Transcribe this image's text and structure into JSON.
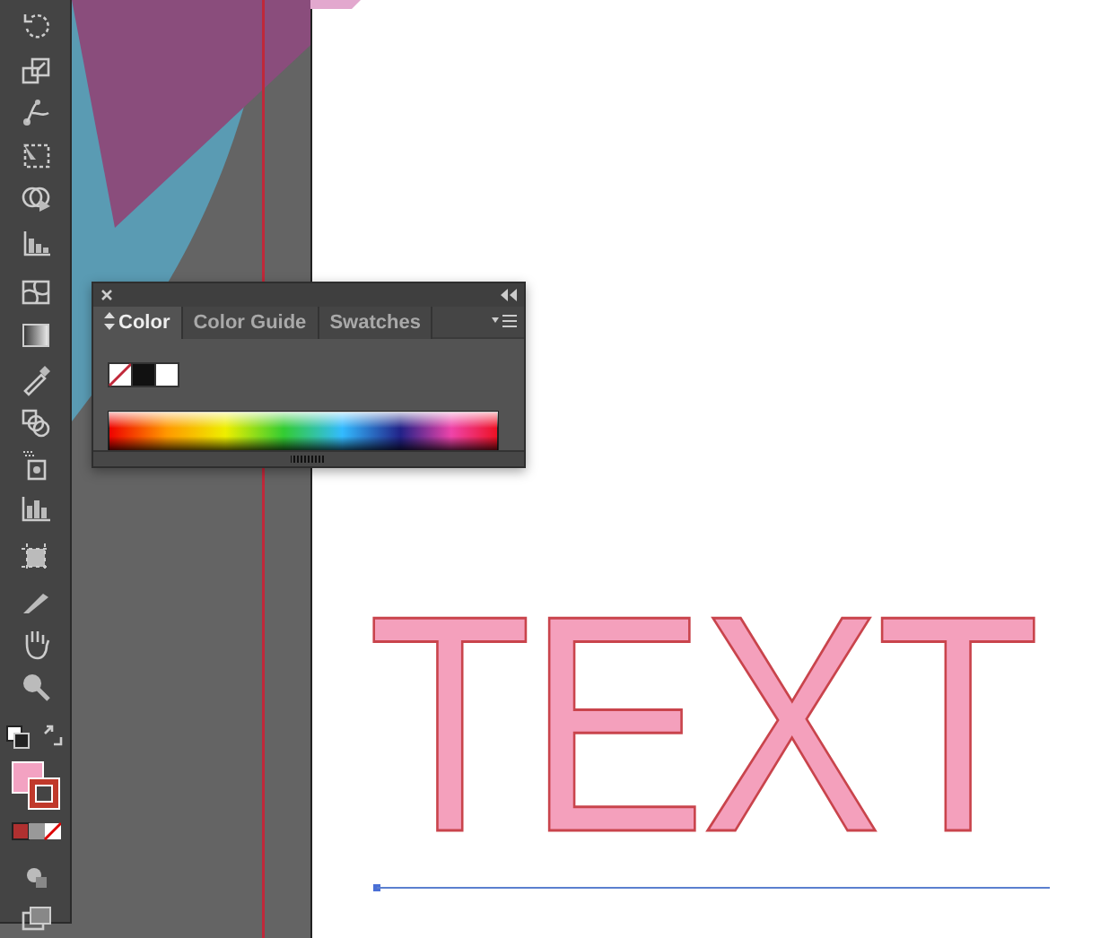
{
  "color_panel": {
    "tabs": [
      {
        "label": "Color",
        "selected": true
      },
      {
        "label": "Color Guide",
        "selected": false
      },
      {
        "label": "Swatches",
        "selected": false
      }
    ]
  },
  "artboard": {
    "text": "TEXT"
  }
}
